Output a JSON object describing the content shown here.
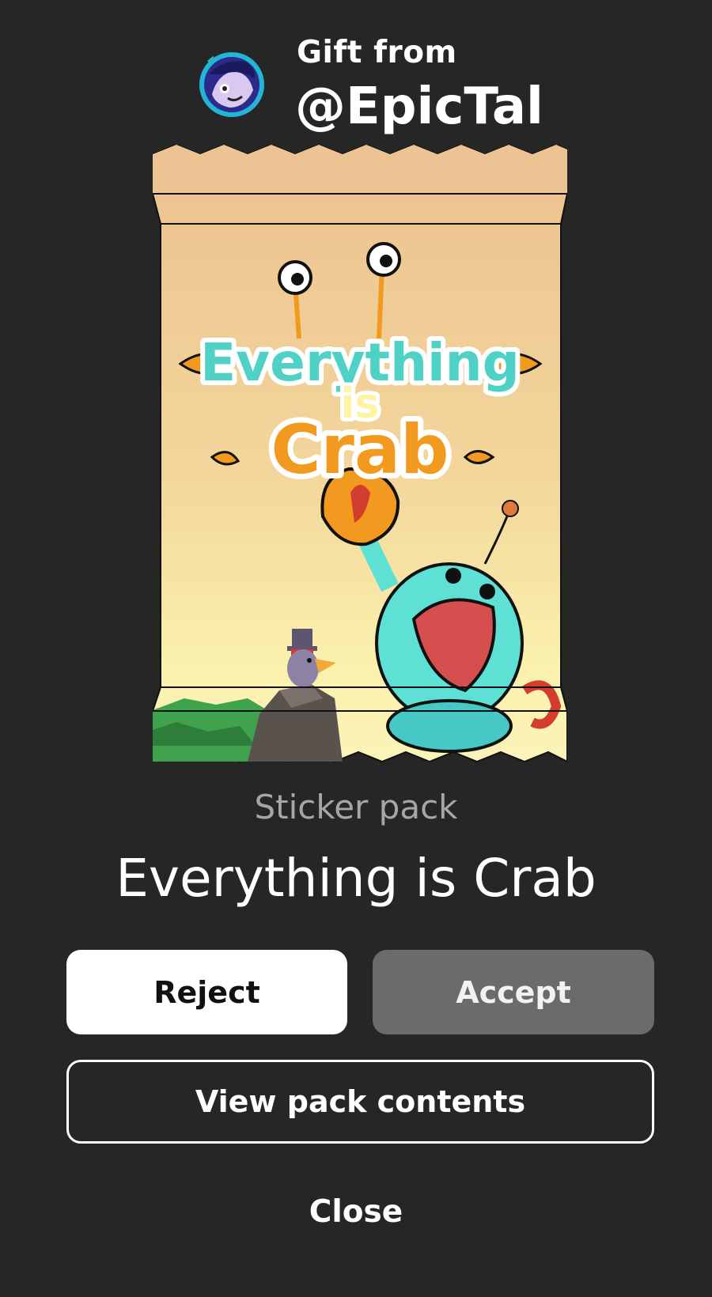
{
  "gift": {
    "from_label": "Gift from",
    "sender": "@EpicTal"
  },
  "pack": {
    "logo_lines": [
      "Everything",
      "is",
      "Crab"
    ],
    "type_label": "Sticker pack",
    "title": "Everything is Crab"
  },
  "actions": {
    "reject_label": "Reject",
    "accept_label": "Accept",
    "view_contents_label": "View pack contents",
    "close_label": "Close"
  },
  "colors": {
    "background": "#262626",
    "pack_paper": "#EDC393",
    "logo_teal": "#4FD1C5",
    "logo_orange": "#F29A1F",
    "accept_button": "#6B6B6B"
  }
}
